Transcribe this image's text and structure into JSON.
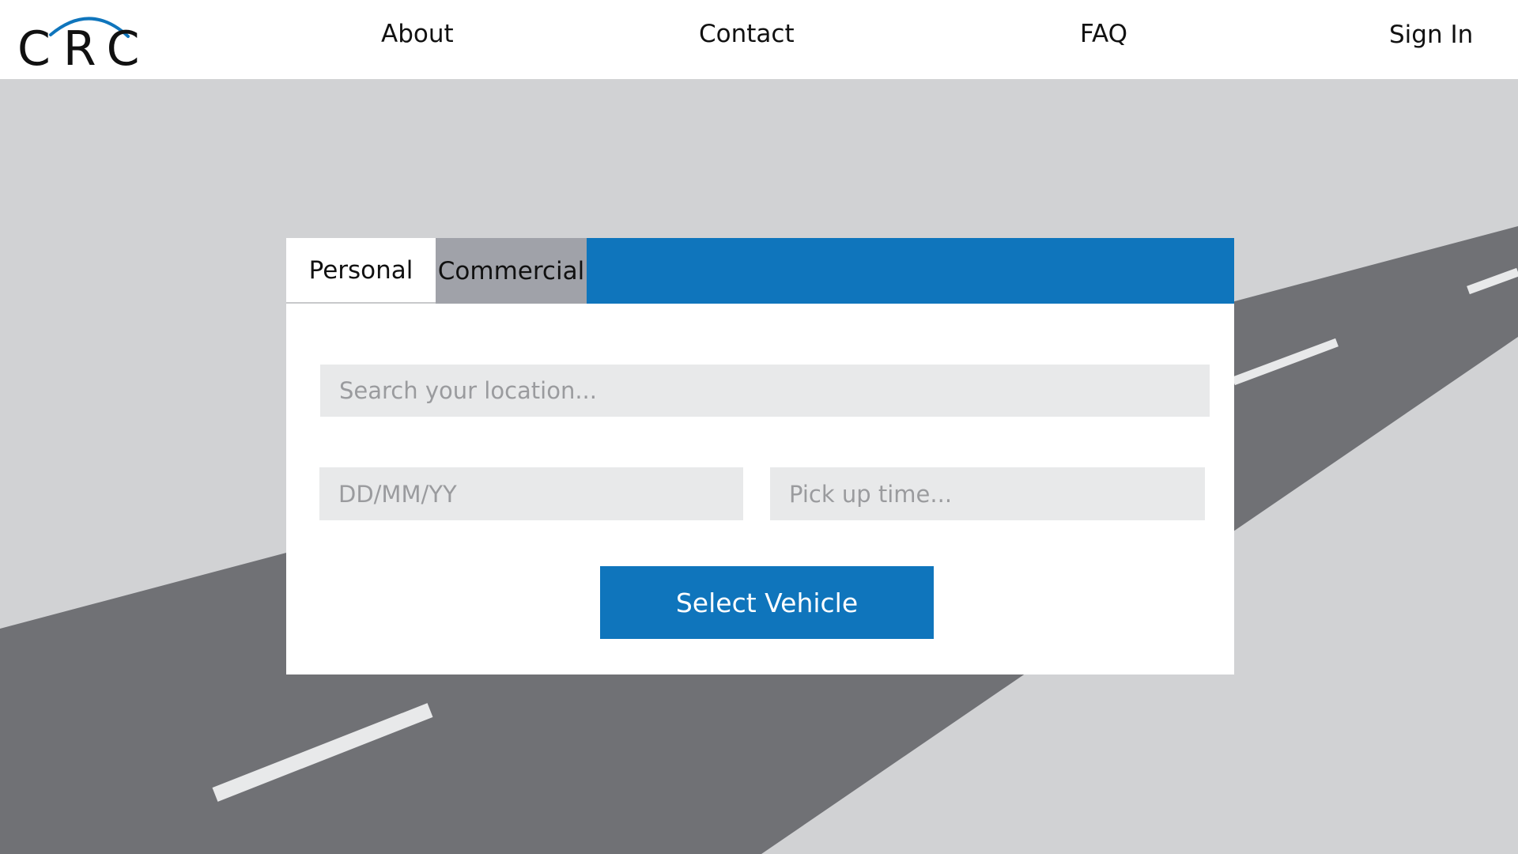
{
  "brand": {
    "logo_text": "CRC",
    "accent_color": "#0f75bc"
  },
  "nav": {
    "about": "About",
    "contact": "Contact",
    "faq": "FAQ",
    "sign_in": "Sign In"
  },
  "booking": {
    "tabs": {
      "personal": "Personal",
      "commercial": "Commercial",
      "selected": "Personal"
    },
    "location_placeholder": "Search your location...",
    "date_placeholder": "DD/MM/YY",
    "time_placeholder": "Pick up time...",
    "submit_label": "Select Vehicle"
  },
  "colors": {
    "background": "#d1d2d4",
    "road": "#707175",
    "lane_marking": "#e8e9ea",
    "inactive_tab": "#a0a2a9",
    "input_fill": "#e8e9ea"
  }
}
